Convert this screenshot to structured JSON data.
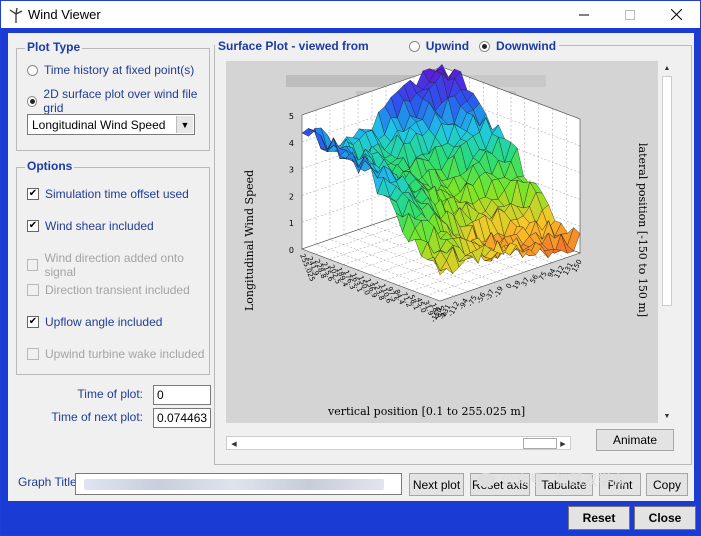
{
  "window": {
    "title": "Wind Viewer"
  },
  "plot_type": {
    "title": "Plot Type",
    "options": [
      {
        "label": "Time history at fixed point(s)",
        "selected": false
      },
      {
        "label": "2D surface plot over wind file grid",
        "selected": true
      }
    ],
    "quantity_select": "Longitudinal Wind Speed"
  },
  "options": {
    "title": "Options",
    "items": [
      {
        "label": "Simulation time offset used",
        "checked": true,
        "enabled": true
      },
      {
        "label": "Wind shear included",
        "checked": true,
        "enabled": true
      },
      {
        "label": "Wind direction added onto signal",
        "checked": false,
        "enabled": false
      },
      {
        "label": "Direction transient included",
        "checked": false,
        "enabled": false
      },
      {
        "label": "Upflow angle included",
        "checked": true,
        "enabled": true
      },
      {
        "label": "Upwind turbine wake included",
        "checked": false,
        "enabled": false
      }
    ]
  },
  "time": {
    "plot_label": "Time of plot:",
    "plot_value": "0",
    "next_label": "Time of next plot:",
    "next_value": "0.074463"
  },
  "surface": {
    "header": "Surface Plot - viewed from",
    "upwind": "Upwind",
    "downwind": "Downwind",
    "view": "downwind",
    "z_label": "Longitudinal Wind Speed",
    "z_ticks": [
      "0",
      "1",
      "2",
      "3",
      "4",
      "5"
    ],
    "x_label": "vertical position [0.1 to 255.025 m]",
    "y_label": "lateral position [-150 to 150 m]",
    "x_ticks": [
      "255.025",
      "241.9",
      "228.8",
      "215.6",
      "202.5",
      "189.4",
      "176.3",
      "163.1",
      "150.0",
      "136.9",
      "123.8",
      "110.6",
      "97.5",
      "84.4",
      "71.2",
      "58.1",
      "45.0",
      "31.9",
      "18.8",
      "5.6"
    ],
    "y_ticks": [
      "-150",
      "-131",
      "-112",
      "-94",
      "-75",
      "-56",
      "-37",
      "-19",
      "0",
      "19",
      "37",
      "56",
      "75",
      "94",
      "112",
      "131",
      "150"
    ]
  },
  "buttons": {
    "animate": "Animate",
    "next_plot": "Next plot",
    "reset_axis": "Reset axis",
    "tabulate": "Tabulate",
    "print": "Print",
    "copy": "Copy",
    "reset": "Reset",
    "close": "Close"
  },
  "graph_title": {
    "label": "Graph Title",
    "value": ""
  },
  "watermark": "公众号 · 智慧双学商"
}
